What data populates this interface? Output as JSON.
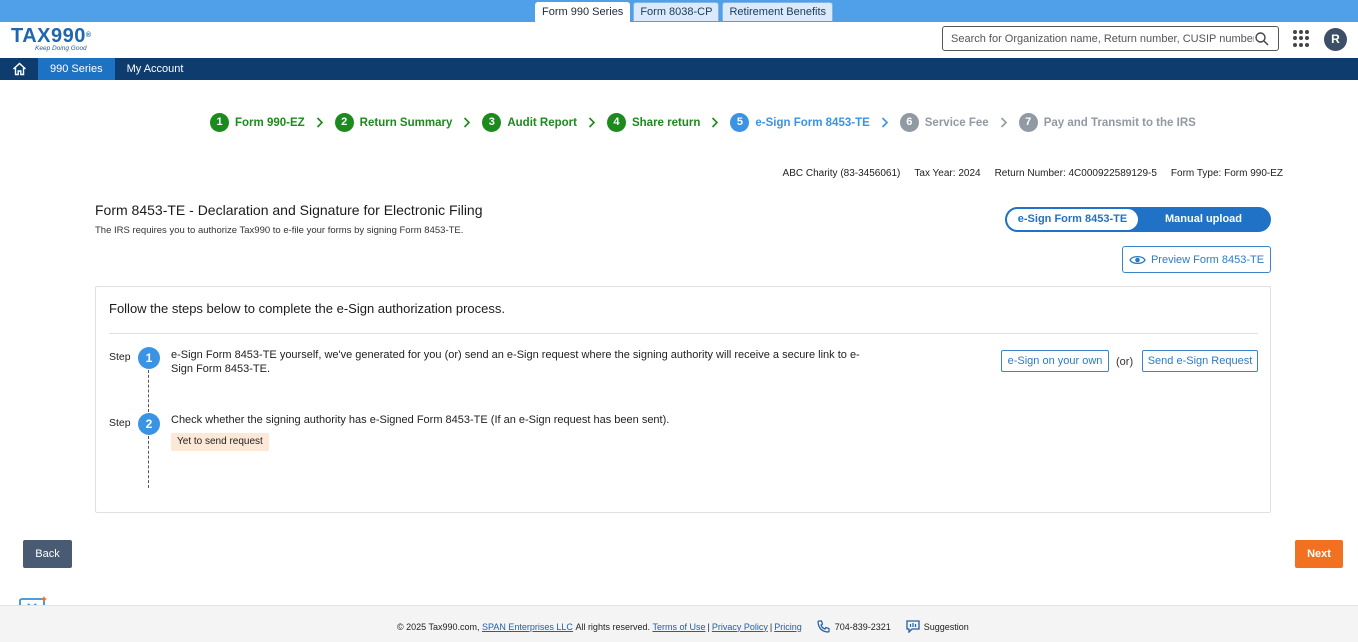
{
  "product_tabs": [
    {
      "label": "Form 990 Series",
      "active": true
    },
    {
      "label": "Form 8038-CP",
      "active": false
    },
    {
      "label": "Retirement Benefits",
      "active": false
    }
  ],
  "header": {
    "logo_text": "TAX990",
    "logo_tagline": "Keep Doing Good",
    "search_placeholder": "Search for Organization name, Return number, CUSIP number",
    "avatar_initial": "R"
  },
  "nav": {
    "items": [
      "990 Series",
      "My Account"
    ]
  },
  "stepper": [
    {
      "num": "1",
      "label": "Form 990-EZ",
      "state": "done"
    },
    {
      "num": "2",
      "label": "Return Summary",
      "state": "done"
    },
    {
      "num": "3",
      "label": "Audit Report",
      "state": "done"
    },
    {
      "num": "4",
      "label": "Share return",
      "state": "done"
    },
    {
      "num": "5",
      "label": "e-Sign Form 8453-TE",
      "state": "current"
    },
    {
      "num": "6",
      "label": "Service Fee",
      "state": "todo"
    },
    {
      "num": "7",
      "label": "Pay and Transmit to the IRS",
      "state": "todo"
    }
  ],
  "return_info": {
    "org": "ABC Charity (83-3456061)",
    "tax_year_label": "Tax Year:",
    "tax_year": "2024",
    "return_number_label": "Return Number:",
    "return_number": "4C000922589129-5",
    "form_type_label": "Form Type:",
    "form_type": "Form 990-EZ"
  },
  "page": {
    "title": "Form 8453-TE - Declaration and Signature for Electronic Filing",
    "subtitle": "The IRS requires you to authorize Tax990 to e-file your forms by signing Form 8453-TE.",
    "toggle_esign": "e-Sign Form 8453-TE",
    "toggle_manual": "Manual upload",
    "preview_label": "Preview Form 8453-TE"
  },
  "panel": {
    "heading": "Follow the steps below to complete the e-Sign authorization process.",
    "step_word": "Step",
    "step1_num": "1",
    "step1_text": "e-Sign Form 8453-TE yourself, we've generated for you (or) send an e-Sign request where the signing authority will receive a secure link to e-Sign Form 8453-TE.",
    "esign_own": "e-Sign on your own",
    "or_text": "(or)",
    "send_request": "Send e-Sign Request",
    "step2_num": "2",
    "step2_text": "Check whether the signing authority has e-Signed Form 8453-TE (If an e-Sign request has been sent).",
    "status_badge": "Yet to send request"
  },
  "actions": {
    "back": "Back",
    "next": "Next"
  },
  "footer": {
    "copyright": "© 2025 Tax990.com,",
    "company": "SPAN Enterprises LLC",
    "rights": "All rights reserved.",
    "terms": "Terms of Use",
    "privacy": "Privacy Policy",
    "pricing": "Pricing",
    "phone": "704-839-2321",
    "suggestion": "Suggestion"
  },
  "colors": {
    "accent": "#1f72c6",
    "done_green": "#1c8a1c",
    "next_orange": "#f27121",
    "nav_dark": "#0f3c6e"
  }
}
